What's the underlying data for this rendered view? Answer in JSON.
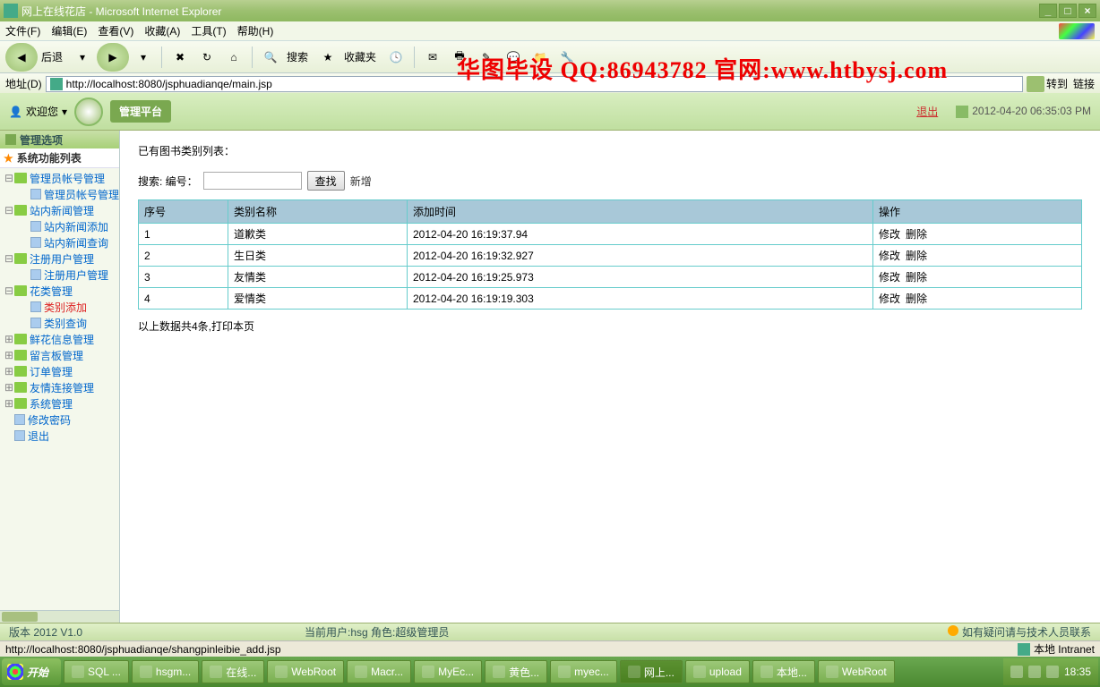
{
  "window": {
    "title": "网上在线花店 - Microsoft Internet Explorer"
  },
  "menus": {
    "file": "文件(F)",
    "edit": "编辑(E)",
    "view": "查看(V)",
    "fav": "收藏(A)",
    "tools": "工具(T)",
    "help": "帮助(H)"
  },
  "toolbar": {
    "back": "后退",
    "search": "搜索",
    "fav": "收藏夹"
  },
  "addr": {
    "label": "地址(D)",
    "url": "http://localhost:8080/jsphuadianqe/main.jsp",
    "go": "转到",
    "links": "链接"
  },
  "watermark": "华图毕设 QQ:86943782 官网:www.htbysj.com",
  "header": {
    "welcome": "欢迎您",
    "platform": "管理平台",
    "quit": "退出",
    "timestamp": "2012-04-20 06:35:03 PM"
  },
  "sidebar": {
    "panel": "管理选项",
    "title": "系统功能列表",
    "nodes": [
      {
        "l": 1,
        "tg": "⊟",
        "t": "fld",
        "label": "管理员帐号管理"
      },
      {
        "l": 2,
        "tg": "",
        "t": "pg",
        "label": "管理员帐号管理"
      },
      {
        "l": 1,
        "tg": "⊟",
        "t": "fld",
        "label": "站内新闻管理"
      },
      {
        "l": 2,
        "tg": "",
        "t": "pg",
        "label": "站内新闻添加"
      },
      {
        "l": 2,
        "tg": "",
        "t": "pg",
        "label": "站内新闻查询"
      },
      {
        "l": 1,
        "tg": "⊟",
        "t": "fld",
        "label": "注册用户管理"
      },
      {
        "l": 2,
        "tg": "",
        "t": "pg",
        "label": "注册用户管理"
      },
      {
        "l": 1,
        "tg": "⊟",
        "t": "fld",
        "label": "花类管理"
      },
      {
        "l": 2,
        "tg": "",
        "t": "pg",
        "label": "类别添加",
        "sel": true
      },
      {
        "l": 2,
        "tg": "",
        "t": "pg",
        "label": "类别查询"
      },
      {
        "l": 1,
        "tg": "⊞",
        "t": "fld",
        "label": "鲜花信息管理"
      },
      {
        "l": 1,
        "tg": "⊞",
        "t": "fld",
        "label": "留言板管理"
      },
      {
        "l": 1,
        "tg": "⊞",
        "t": "fld",
        "label": "订单管理"
      },
      {
        "l": 1,
        "tg": "⊞",
        "t": "fld",
        "label": "友情连接管理"
      },
      {
        "l": 1,
        "tg": "⊞",
        "t": "fld",
        "label": "系统管理"
      },
      {
        "l": 1,
        "tg": "",
        "t": "pg",
        "label": "修改密码"
      },
      {
        "l": 1,
        "tg": "",
        "t": "pg",
        "label": "退出"
      }
    ]
  },
  "content": {
    "caption": "已有图书类别列表：",
    "search_label": "搜索: 编号：",
    "search_value": "",
    "search_btn": "查找",
    "add_link": "新增",
    "columns": [
      "序号",
      "类别名称",
      "添加时间",
      "操作"
    ],
    "rows": [
      {
        "no": "1",
        "name": "道歉类",
        "time": "2012-04-20 16:19:37.94"
      },
      {
        "no": "2",
        "name": "生日类",
        "time": "2012-04-20 16:19:32.927"
      },
      {
        "no": "3",
        "name": "友情类",
        "time": "2012-04-20 16:19:25.973"
      },
      {
        "no": "4",
        "name": "爱情类",
        "time": "2012-04-20 16:19:19.303"
      }
    ],
    "op_edit": "修改",
    "op_del": "删除",
    "summary": "以上数据共4条,打印本页"
  },
  "footer": {
    "version": "版本 2012 V1.0",
    "user": "当前用户:hsg  角色:超级管理员",
    "help": "如有疑问请与技术人员联系"
  },
  "iestatus": {
    "url": "http://localhost:8080/jsphuadianqe/shangpinleibie_add.jsp",
    "zone": "本地 Intranet"
  },
  "taskbar": {
    "start": "开始",
    "items": [
      {
        "label": "SQL ..."
      },
      {
        "label": "hsgm..."
      },
      {
        "label": "在线..."
      },
      {
        "label": "WebRoot"
      },
      {
        "label": "Macr..."
      },
      {
        "label": "MyEc..."
      },
      {
        "label": "黄色..."
      },
      {
        "label": "myec..."
      },
      {
        "label": "网上...",
        "act": true
      },
      {
        "label": "upload"
      },
      {
        "label": "本地..."
      },
      {
        "label": "WebRoot"
      }
    ],
    "time": "18:35"
  }
}
